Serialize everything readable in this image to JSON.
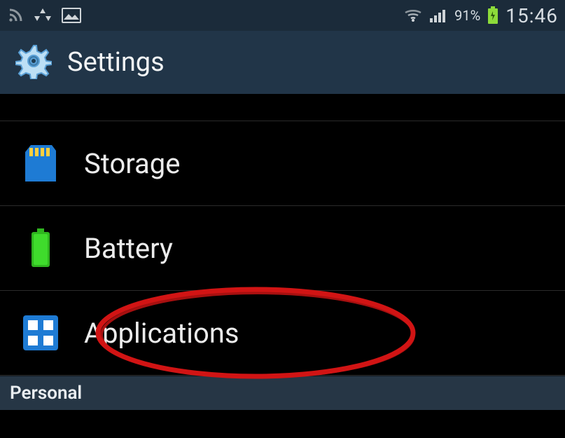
{
  "status_bar": {
    "battery_percent": "91%",
    "clock": "15:46"
  },
  "header": {
    "title": "Settings"
  },
  "items": {
    "storage": {
      "label": "Storage"
    },
    "battery": {
      "label": "Battery"
    },
    "applications": {
      "label": "Applications"
    }
  },
  "sections": {
    "personal": "Personal"
  }
}
